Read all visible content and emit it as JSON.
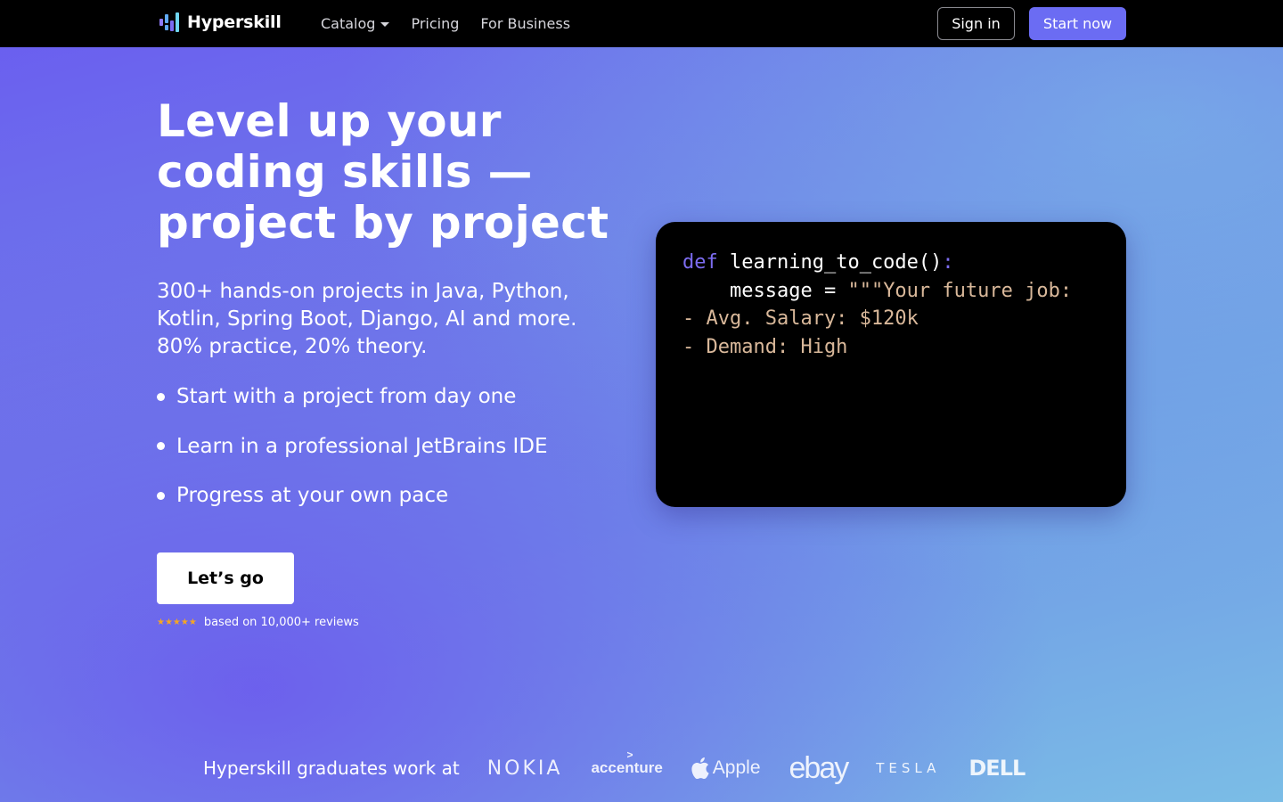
{
  "header": {
    "brand": "Hyperskill",
    "nav": [
      {
        "label": "Catalog",
        "has_dropdown": true
      },
      {
        "label": "Pricing",
        "has_dropdown": false
      },
      {
        "label": "For Business",
        "has_dropdown": false
      }
    ],
    "sign_in_label": "Sign in",
    "start_now_label": "Start now"
  },
  "hero": {
    "title_lines": [
      "Level up your",
      "coding skills —",
      "project by project"
    ],
    "subtitle_lines": [
      "300+ hands-on projects in Java, Python,",
      "Kotlin, Spring Boot, Django, AI and more.",
      "80% practice, 20% theory."
    ],
    "bullets": [
      "Start with a project from day one",
      "Learn in a professional JetBrains IDE",
      "Progress at your own pace"
    ],
    "cta_label": "Let’s go",
    "rating_stars": 5,
    "reviews_text": "based on 10,000+ reviews"
  },
  "code": {
    "keyword": "def",
    "function_name": "learning_to_code",
    "parens": "()",
    "colon": ":",
    "var_name": "message",
    "operator": "=",
    "string_start": "\"\"\"Your future job:",
    "lines": [
      "- Avg. Salary: $120k",
      "- Demand: High"
    ]
  },
  "companies": {
    "label": "Hyperskill graduates work at",
    "logos": [
      "NOKIA",
      "accenture",
      "Apple",
      "ebay",
      "TESLA",
      "DELL"
    ]
  },
  "colors": {
    "accent": "#6b6cf3",
    "header_bg": "#000000",
    "star": "#f5a623",
    "code_keyword": "#7c6cf0",
    "code_string": "#d9b89a"
  }
}
